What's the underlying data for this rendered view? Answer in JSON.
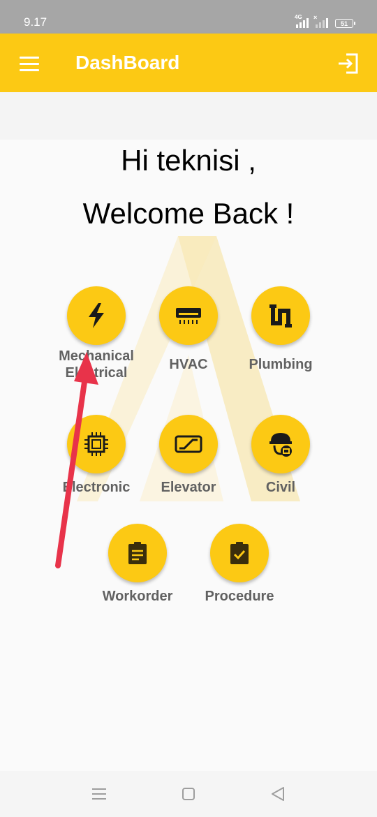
{
  "status_bar": {
    "time": "9.17",
    "network": "4G",
    "battery": "51"
  },
  "app_bar": {
    "title": "DashBoard",
    "menu_icon": "hamburger-menu-icon",
    "logout_icon": "logout-icon"
  },
  "greeting": {
    "line1": "Hi teknisi ,",
    "line2": "Welcome Back !"
  },
  "menu": [
    {
      "label": "Mechanical\nElectrical",
      "icon": "lightning-bolt-icon"
    },
    {
      "label": "HVAC",
      "icon": "air-conditioner-icon"
    },
    {
      "label": "Plumbing",
      "icon": "pipe-icon"
    },
    {
      "label": "Electronic",
      "icon": "chip-icon"
    },
    {
      "label": "Elevator",
      "icon": "escalator-icon"
    },
    {
      "label": "Civil",
      "icon": "worker-helmet-icon"
    },
    {
      "label": "Workorder",
      "icon": "clipboard-list-icon"
    },
    {
      "label": "Procedure",
      "icon": "clipboard-check-icon"
    }
  ],
  "nav_bar": {
    "recents_icon": "recents-icon",
    "home_icon": "home-icon",
    "back_icon": "back-icon"
  },
  "colors": {
    "accent": "#fcc914",
    "label": "#616161",
    "annotation_arrow": "#e8334a"
  }
}
